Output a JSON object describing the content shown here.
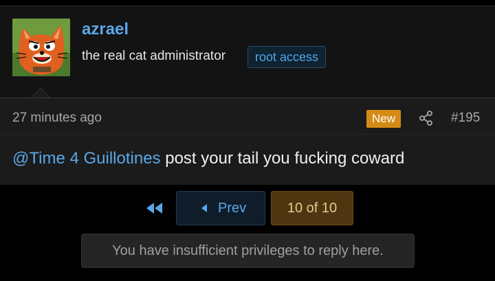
{
  "post": {
    "user": {
      "name": "azrael",
      "title": "the real cat administrator",
      "badge": "root access",
      "avatar_icon": "cartoon-cat-avatar"
    },
    "time_ago": "27 minutes ago",
    "new_label": "New",
    "post_number": "#195",
    "message": {
      "mention": "@Time 4 Guillotines",
      "text": " post your tail you fucking coward"
    }
  },
  "pager": {
    "prev_label": "Prev",
    "current": "10 of 10"
  },
  "notice": "You have insufficient privileges to reply here.",
  "colors": {
    "link": "#5aa7e8",
    "new_badge": "#d68a16",
    "current_page": "#4f3611"
  }
}
